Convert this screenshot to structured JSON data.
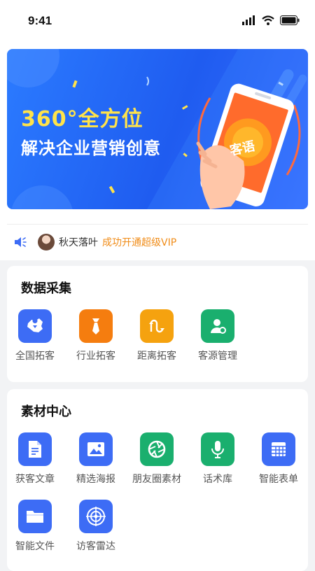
{
  "status_bar": {
    "time": "9:41"
  },
  "banner": {
    "headline": "360°全方位",
    "subline": "解决企业营销创意",
    "phone_badge": "客语"
  },
  "notice": {
    "user_name": "秋天落叶",
    "message": "成功开通超级VIP"
  },
  "data_collection": {
    "title": "数据采集",
    "items": [
      {
        "label": "全国拓客",
        "icon": "china-map-icon",
        "color": "#3d6cf5"
      },
      {
        "label": "行业拓客",
        "icon": "tie-icon",
        "color": "#f57d0f"
      },
      {
        "label": "距离拓客",
        "icon": "route-icon",
        "color": "#f5a20f"
      },
      {
        "label": "客源管理",
        "icon": "user-gear-icon",
        "color": "#1aaf6e"
      }
    ]
  },
  "material_center": {
    "title": "素材中心",
    "items": [
      {
        "label": "获客文章",
        "icon": "document-icon",
        "color": "#3d6cf5"
      },
      {
        "label": "精选海报",
        "icon": "image-icon",
        "color": "#3d6cf5"
      },
      {
        "label": "朋友圈素材",
        "icon": "aperture-icon",
        "color": "#1aaf6e"
      },
      {
        "label": "话术库",
        "icon": "microphone-icon",
        "color": "#1aaf6e"
      },
      {
        "label": "智能表单",
        "icon": "grid-form-icon",
        "color": "#3d6cf5"
      },
      {
        "label": "智能文件",
        "icon": "folder-icon",
        "color": "#3d6cf5"
      },
      {
        "label": "访客雷达",
        "icon": "radar-icon",
        "color": "#3d6cf5"
      }
    ]
  }
}
